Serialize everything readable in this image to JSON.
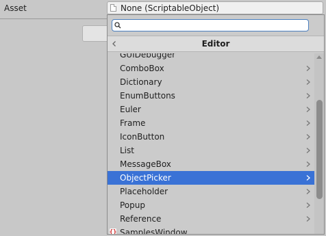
{
  "inspector": {
    "asset_label": "Asset",
    "asset_value": "None (ScriptableObject)"
  },
  "popup": {
    "search_value": "",
    "header_title": "Editor",
    "partial_item": "GUIDebugger",
    "items": [
      {
        "label": "ComboBox",
        "selected": false,
        "icon": null
      },
      {
        "label": "Dictionary",
        "selected": false,
        "icon": null
      },
      {
        "label": "EnumButtons",
        "selected": false,
        "icon": null
      },
      {
        "label": "Euler",
        "selected": false,
        "icon": null
      },
      {
        "label": "Frame",
        "selected": false,
        "icon": null
      },
      {
        "label": "IconButton",
        "selected": false,
        "icon": null
      },
      {
        "label": "List",
        "selected": false,
        "icon": null
      },
      {
        "label": "MessageBox",
        "selected": false,
        "icon": null
      },
      {
        "label": "ObjectPicker",
        "selected": true,
        "icon": null
      },
      {
        "label": "Placeholder",
        "selected": false,
        "icon": null
      },
      {
        "label": "Popup",
        "selected": false,
        "icon": null
      },
      {
        "label": "Reference",
        "selected": false,
        "icon": null
      },
      {
        "label": "SamplesWindow",
        "selected": false,
        "icon": "script-icon"
      }
    ],
    "script_icon_text": "{}"
  },
  "colors": {
    "selection": "#3a72d6",
    "background": "#c8c8c8"
  },
  "icons": {
    "search": "search-icon",
    "back": "chevron-left-icon",
    "submenu": "chevron-right-icon",
    "document": "document-icon"
  }
}
